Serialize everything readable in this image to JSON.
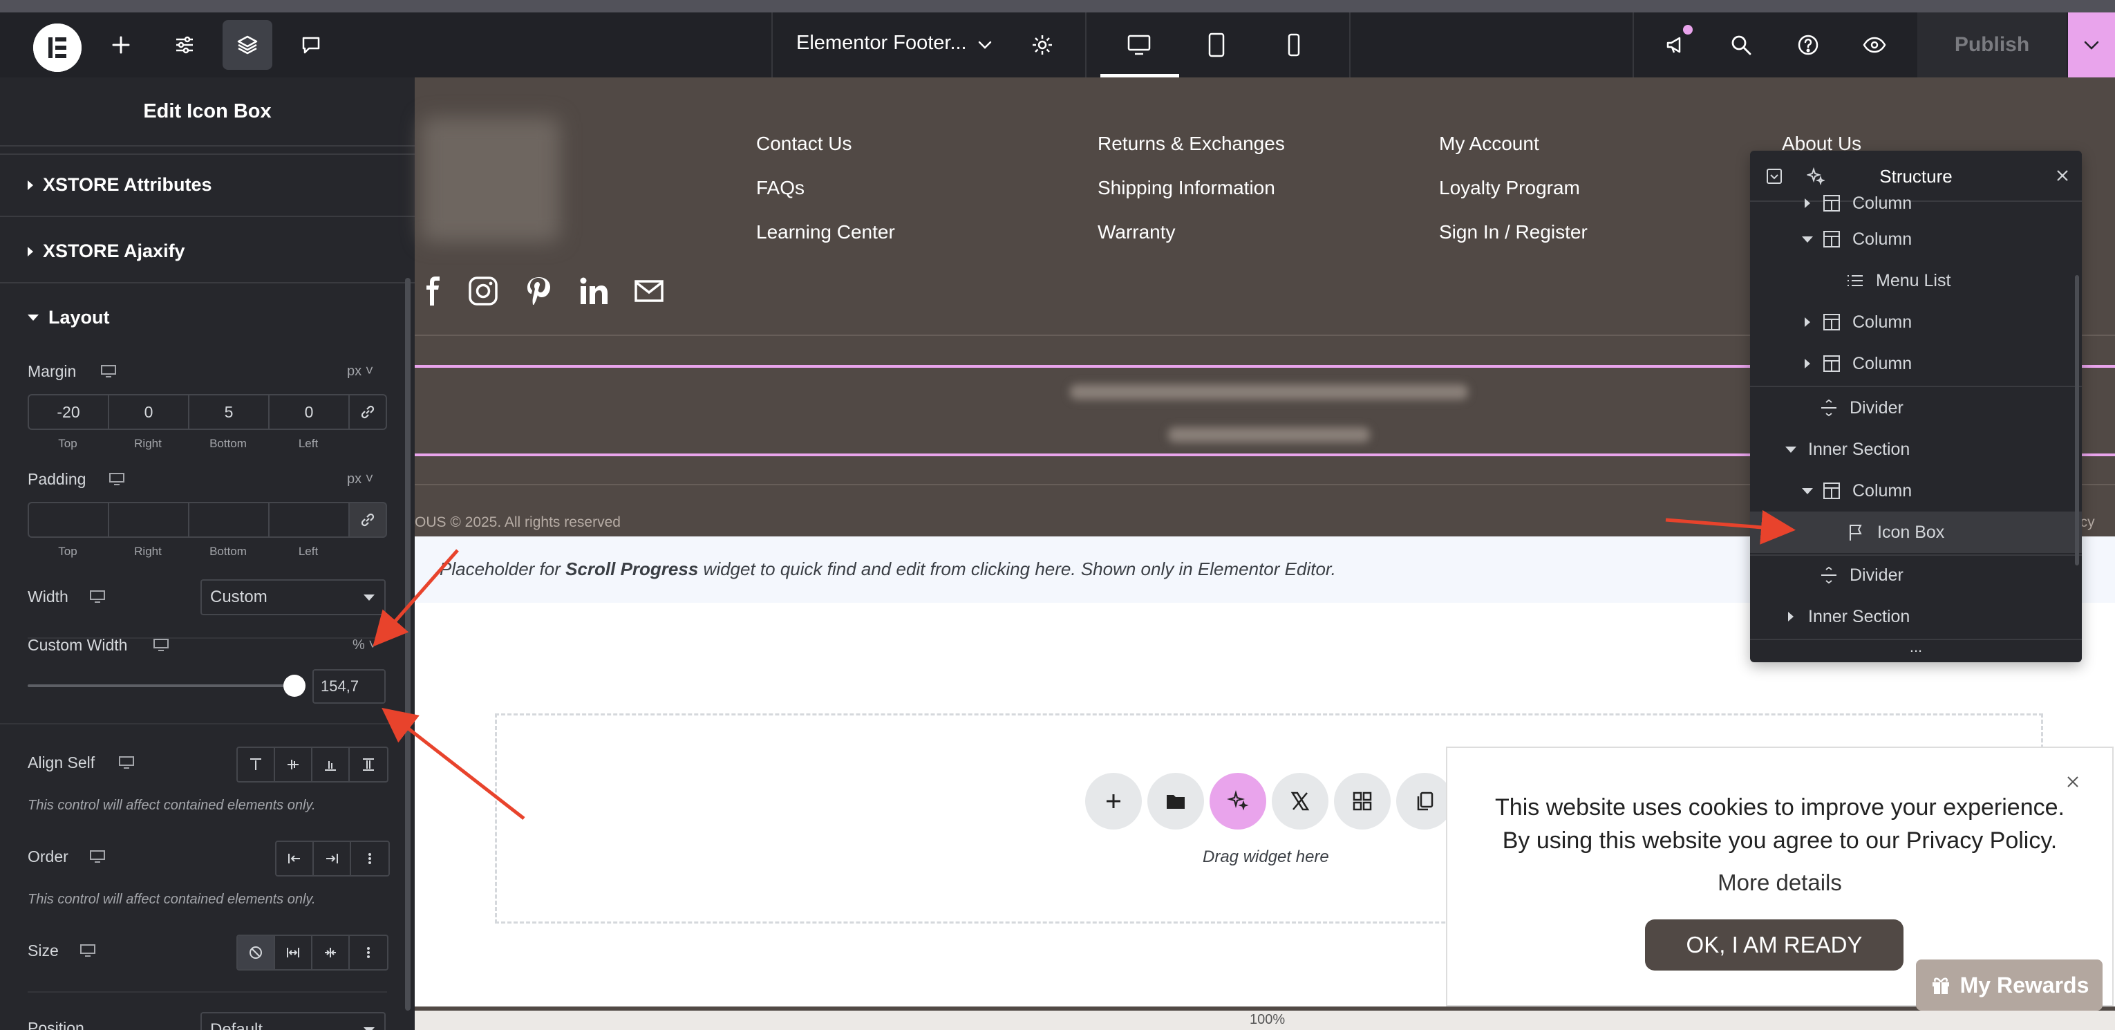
{
  "topbar": {
    "document_title": "Elementor Footer...",
    "publish_label": "Publish"
  },
  "panel": {
    "title": "Edit Icon Box",
    "sections": {
      "xstore_attributes": "XSTORE Attributes",
      "xstore_ajaxify": "XSTORE Ajaxify",
      "layout": "Layout"
    },
    "margin": {
      "label": "Margin",
      "unit": "px",
      "top": "-20",
      "right": "0",
      "bottom": "5",
      "left": "0"
    },
    "padding": {
      "label": "Padding",
      "unit": "px",
      "top": "",
      "right": "",
      "bottom": "",
      "left": ""
    },
    "dim_labels": {
      "top": "Top",
      "right": "Right",
      "bottom": "Bottom",
      "left": "Left"
    },
    "width": {
      "label": "Width",
      "value": "Custom"
    },
    "custom_width": {
      "label": "Custom Width",
      "unit": "%",
      "value": "154,7"
    },
    "align_self": {
      "label": "Align Self",
      "hint": "This control will affect contained elements only."
    },
    "order": {
      "label": "Order",
      "hint": "This control will affect contained elements only."
    },
    "size": {
      "label": "Size"
    },
    "position": {
      "label": "Position",
      "value": "Default"
    }
  },
  "footer": {
    "menu_col1": [
      "Contact Us",
      "FAQs",
      "Learning Center"
    ],
    "menu_col2": [
      "Returns & Exchanges",
      "Shipping Information",
      "Warranty"
    ],
    "menu_col3": [
      "My Account",
      "Loyalty Program",
      "Sign In / Register"
    ],
    "menu_col4": [
      "About Us"
    ],
    "copyright": "OUS © 2025. All rights reserved",
    "copyright_right": "acy"
  },
  "placeholder": {
    "prefix": "Placeholder for ",
    "widget": "Scroll Progress",
    "suffix": " widget to quick find and edit from clicking here. Shown only in Elementor Editor."
  },
  "dropzone": {
    "label": "Drag widget here"
  },
  "zoom": "100%",
  "structure": {
    "title": "Structure",
    "rows": [
      {
        "label": "Column",
        "type": "column"
      },
      {
        "label": "Column",
        "type": "column"
      },
      {
        "label": "Menu List",
        "type": "widget"
      },
      {
        "label": "Column",
        "type": "column"
      },
      {
        "label": "Column",
        "type": "column"
      },
      {
        "label": "Divider",
        "type": "divider"
      },
      {
        "label": "Inner Section",
        "type": "section"
      },
      {
        "label": "Column",
        "type": "column"
      },
      {
        "label": "Icon Box",
        "type": "widget",
        "selected": true
      },
      {
        "label": "Divider",
        "type": "divider"
      },
      {
        "label": "Inner Section",
        "type": "section"
      }
    ],
    "more": "..."
  },
  "cookie": {
    "text_line1": "This website uses cookies to improve your experience.",
    "text_line2": "By using this website you agree to our Privacy Policy.",
    "more_details": "More details",
    "ok_label": "OK, I AM READY"
  },
  "rewards": {
    "label": "My Rewards"
  },
  "colors": {
    "topbar": "#212227",
    "panel": "#26272c",
    "footer_bg": "#514945",
    "accent_pink": "#e9a4ec",
    "arrow_red": "#e8432c"
  },
  "icons": {
    "topbar": [
      "elementor-logo-icon",
      "add-element-icon",
      "settings-sliders-icon",
      "layers-icon",
      "comments-icon",
      "chevron-down-icon",
      "gear-icon",
      "desktop-icon",
      "tablet-icon",
      "mobile-icon",
      "announcement-icon",
      "search-icon",
      "help-icon",
      "preview-eye-icon"
    ],
    "social": [
      "facebook-icon",
      "instagram-icon",
      "pinterest-icon",
      "linkedin-icon",
      "email-icon"
    ]
  }
}
